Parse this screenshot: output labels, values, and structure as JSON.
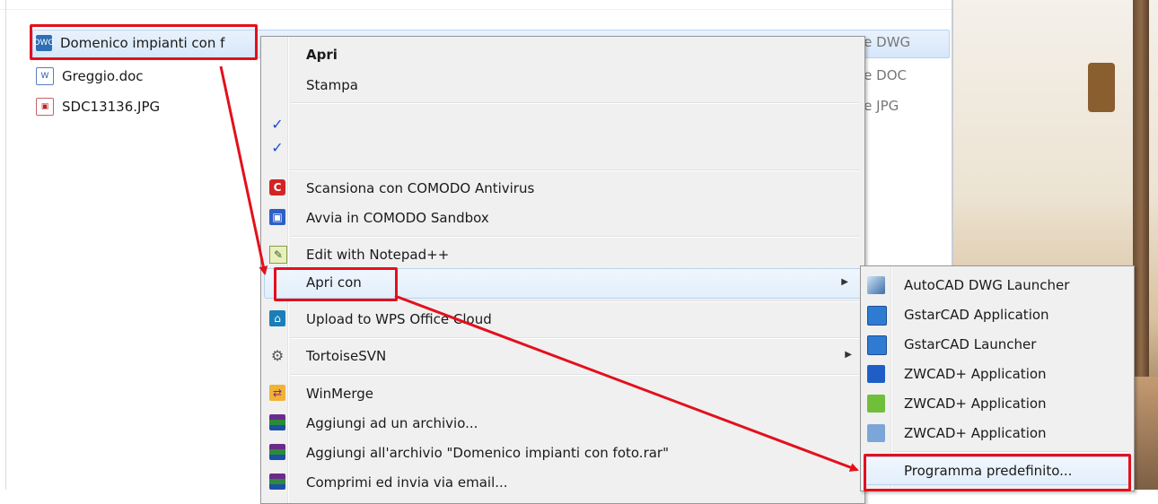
{
  "files": [
    {
      "name": "Domenico impianti con f",
      "type": "le DWG",
      "icon": "dwg-file-icon"
    },
    {
      "name": "Greggio.doc",
      "type": "le DOC",
      "icon": "doc-file-icon"
    },
    {
      "name": "SDC13136.JPG",
      "type": "le JPG",
      "icon": "jpg-file-icon"
    }
  ],
  "context_menu": {
    "open": "Apri",
    "print": "Stampa",
    "comodo_scan": "Scansiona con COMODO Antivirus",
    "comodo_sandbox": "Avvia in COMODO Sandbox",
    "notepadpp": "Edit with Notepad++",
    "open_with": "Apri con",
    "wps_upload": "Upload to WPS Office Cloud",
    "tortoise": "TortoiseSVN",
    "winmerge": "WinMerge",
    "add_archive": "Aggiungi ad un archivio...",
    "add_to_rar": "Aggiungi all'archivio \"Domenico impianti con foto.rar\"",
    "compress_email": "Comprimi ed invia via email..."
  },
  "submenu": {
    "items": [
      "AutoCAD DWG Launcher",
      "GstarCAD Application",
      "GstarCAD Launcher",
      "ZWCAD+ Application",
      "ZWCAD+ Application",
      "ZWCAD+ Application"
    ],
    "default_program": "Programma predefinito..."
  },
  "colors": {
    "highlight": "#e3101c",
    "menu_bg": "#f0f0f0",
    "selection": "#d6e7fb"
  }
}
